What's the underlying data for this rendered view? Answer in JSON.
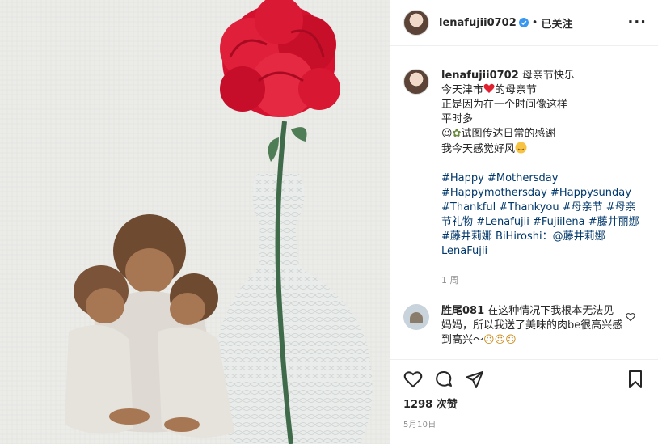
{
  "post": {
    "username": "lenafujii0702",
    "dot": "•",
    "follow_status": "已关注",
    "more_icon": "more-options-icon"
  },
  "caption": {
    "username": "lenafujii0702",
    "line1": "母亲节快乐",
    "line2_a": "今天津市",
    "line2_b": "的母亲节",
    "line3": "正是因为在一个时间像这样",
    "line4": "平时多",
    "line5": "试图传达日常的感谢",
    "line6": "我今天感觉好风",
    "hashtags": "#Happy #Mothersday #Happymothersday #Happysunday #Thankful #Thankyou #母亲节 #母亲节礼物 #Lenafujii #Fujiilena #藤井丽娜 #藤井莉娜 BiHiroshi：@藤井莉娜LenaFujii",
    "time": "1 周"
  },
  "comment": {
    "username": "胜尾081",
    "text": "在这种情况下我根本无法见妈妈，所以我送了美味的肉be很高兴感到高兴〜"
  },
  "footer": {
    "likes": "1298 次赞",
    "date": "5月10日"
  },
  "colors": {
    "link": "#00376b",
    "verified": "#3897f0",
    "heart": "#ed4956"
  }
}
